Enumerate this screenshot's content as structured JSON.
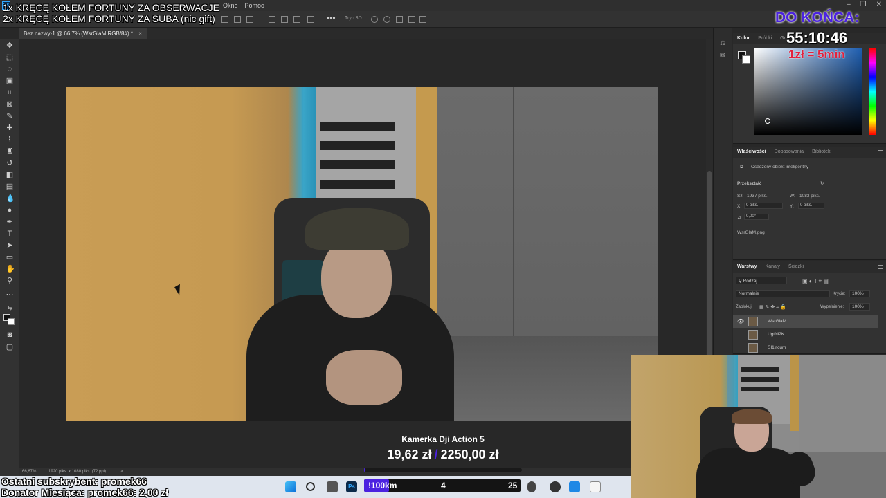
{
  "menubar": {
    "menus": [
      "Okno",
      "Pomoc"
    ]
  },
  "options_bar": {
    "mode_3d": "Tryb 3D:"
  },
  "document": {
    "tab_title": "Bez nazwy-1 @ 66,7% (WsrGlaM,RGB/8#) *",
    "close": "×"
  },
  "status": {
    "zoom": "66,67%",
    "size": "1920 piks. x 1080 piks. (72 ppi)",
    "arrow": ">"
  },
  "color_panel": {
    "tabs": [
      "Kolor",
      "Próbki",
      "Gr"
    ]
  },
  "properties_panel": {
    "tabs": [
      "Właściwości",
      "Dopasowania",
      "Biblioteki"
    ],
    "object_type": "Osadzony obiekt inteligentny",
    "transform_label": "Przekształć",
    "width_label": "Sz:",
    "width_value": "1937 piks.",
    "height_label": "W:",
    "height_value": "1083 piks.",
    "x_label": "X:",
    "x_value": "0 piks.",
    "y_label": "Y:",
    "y_value": "0 piks.",
    "angle_value": "0,00°",
    "file_name": "WsrGlaM.png"
  },
  "layers_panel": {
    "tabs": [
      "Warstwy",
      "Kanały",
      "Ścieżki"
    ],
    "filter": "Rodzaj",
    "blend_mode": "Normalnie",
    "opacity_label": "Krycie:",
    "opacity_value": "100%",
    "lock_label": "Zablokuj:",
    "fill_label": "Wypełnienie:",
    "fill_value": "100%",
    "layers": [
      {
        "name": "WsrGlaM",
        "selected": true
      },
      {
        "name": "UgtNi2K",
        "selected": false
      },
      {
        "name": "SI1Ycum",
        "selected": false
      }
    ]
  },
  "overlays": {
    "top_left": [
      "1x KRĘCĘ KOŁEM FORTUNY ZA OBSERWACJE",
      "2x KRĘCĘ KOŁEM FORTUNY ZA SUBA (nic gift)"
    ],
    "timer_title": "DO KOŃCA:",
    "timer": "55:10:46",
    "rate": "1zł = 5min",
    "goal_title": "Kamerka Dji Action 5",
    "goal_current": "19,62 zł",
    "goal_target": "2250,00 zł",
    "goal_progress": 0.0087,
    "last_sub": "Ostatni subskrybent: promek66",
    "donor": "Donator Miesiąca: promek66: 2,00 zł"
  },
  "km_bar": {
    "label": "!100km",
    "current": "4",
    "target": "25",
    "progress": 0.16
  },
  "colors": {
    "accent": "#4b22e0",
    "rate_red": "#e5213c",
    "ps_blue": "#31a8ff"
  }
}
